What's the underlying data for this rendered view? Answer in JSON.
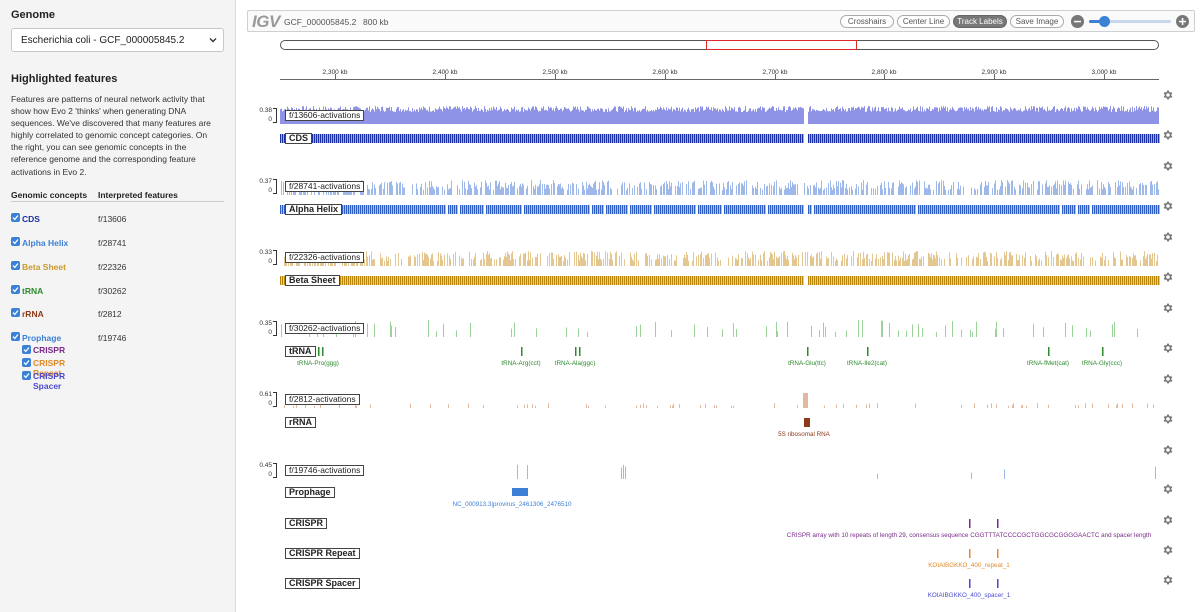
{
  "sidebar": {
    "genome_heading": "Genome",
    "genome_select": "Escherichia coli - GCF_000005845.2",
    "highlighted_heading": "Highlighted features",
    "description": "Features are patterns of neural network activity that show how Evo 2 'thinks' when generating DNA sequences. We've discovered that many features are highly correlated to genomic concept categories. On the right, you can see genomic concepts in the reference genome and the corresponding feature activations in Evo 2.",
    "col_concepts": "Genomic concepts",
    "col_features": "Interpreted features",
    "concepts": [
      {
        "label": "CDS",
        "feature": "f/13606",
        "color": "#1a2fa3",
        "checked": true
      },
      {
        "label": "Alpha Helix",
        "feature": "f/28741",
        "color": "#3d7fd6",
        "checked": true
      },
      {
        "label": "Beta Sheet",
        "feature": "f/22326",
        "color": "#c99a2e",
        "checked": true
      },
      {
        "label": "tRNA",
        "feature": "f/30262",
        "color": "#2d8a2d",
        "checked": true
      },
      {
        "label": "rRNA",
        "feature": "f/2812",
        "color": "#8b3a1a",
        "checked": true
      },
      {
        "label": "Prophage",
        "feature": "f/19746",
        "color": "#3d7fd6",
        "checked": true
      }
    ],
    "sub_concepts": [
      {
        "label": "CRISPR",
        "color": "#7a2a8a",
        "checked": true
      },
      {
        "label": "CRISPR Repeat",
        "color": "#e08a2a",
        "checked": true
      },
      {
        "label": "CRISPR Spacer",
        "color": "#4a4ad0",
        "checked": true
      }
    ]
  },
  "igv": {
    "logo": "IGV",
    "assembly": "GCF_000005845.2",
    "span": "800 kb",
    "buttons": [
      "Crosshairs",
      "Center Line",
      "Track Labels",
      "Save Image"
    ],
    "active_button": "Track Labels",
    "zoom_level": 0.18,
    "ruler_ticks": [
      "2,300 kb",
      "2,400 kb",
      "2,500 kb",
      "2,600 kb",
      "2,700 kb",
      "2,800 kb",
      "2,900 kb",
      "3,000 kb"
    ],
    "tracks": [
      {
        "activation_label": "f/13606-activations",
        "max": "0.38",
        "min": "0",
        "act_color": "#8f93e6",
        "style": "dense",
        "annotations": [
          {
            "name": "CDS",
            "color": "#1a2fa3",
            "style": "dense"
          }
        ]
      },
      {
        "activation_label": "f/28741-activations",
        "max": "0.37",
        "min": "0",
        "act_color": "#9fb8ea",
        "style": "medium",
        "annotations": [
          {
            "name": "Alpha Helix",
            "color": "#2f5fc4",
            "style": "dense-gapped"
          }
        ]
      },
      {
        "activation_label": "f/22326-activations",
        "max": "0.33",
        "min": "0",
        "act_color": "#e3c690",
        "style": "medium",
        "annotations": [
          {
            "name": "Beta Sheet",
            "color": "#b8860b",
            "style": "dense"
          }
        ]
      },
      {
        "activation_label": "f/30262-activations",
        "max": "0.35",
        "min": "0",
        "act_color": "#9ad29a",
        "style": "sparse",
        "annotations": [
          {
            "name": "tRNA",
            "color": "#2d8a2d",
            "style": "features",
            "labels": [
              "tRNA-Pro(ggg)",
              "tRNA-Arg(cct)",
              "tRNA-Ala(ggc)",
              "tRNA-Glu(ttc)",
              "tRNA-Ile2(cat)",
              "tRNA-fMet(cat)",
              "tRNA-Gly(ccc)"
            ]
          }
        ]
      },
      {
        "activation_label": "f/2812-activations",
        "max": "0.61",
        "min": "0",
        "act_color": "#e2b9a0",
        "style": "tiny",
        "annotations": [
          {
            "name": "rRNA",
            "color": "#8b3a1a",
            "style": "features",
            "labels": [
              "5S ribosomal RNA"
            ]
          }
        ]
      },
      {
        "activation_label": "f/19746-activations",
        "max": "0.45",
        "min": "0",
        "act_color": "#9fb8ea",
        "style": "rare",
        "annotations": [
          {
            "name": "Prophage",
            "color": "#3d7fd6",
            "style": "features",
            "labels": [
              "NC_000913.3|provirus_2461306_2476510"
            ]
          },
          {
            "name": "CRISPR",
            "color": "#7a2a8a",
            "style": "features",
            "labels": [
              "CRISPR array with 10 repeats of length 29, consensus sequence CGGTTTATCCCCGCTGGCGCGGGGAACTC and spacer length"
            ]
          },
          {
            "name": "CRISPR Repeat",
            "color": "#e08a2a",
            "style": "features",
            "labels": [
              "KOIAIBGKKO_400_repeat_1"
            ]
          },
          {
            "name": "CRISPR Spacer",
            "color": "#4a4ad0",
            "style": "features",
            "labels": [
              "KOIAIBGKKO_400_spacer_1"
            ]
          }
        ]
      }
    ]
  }
}
